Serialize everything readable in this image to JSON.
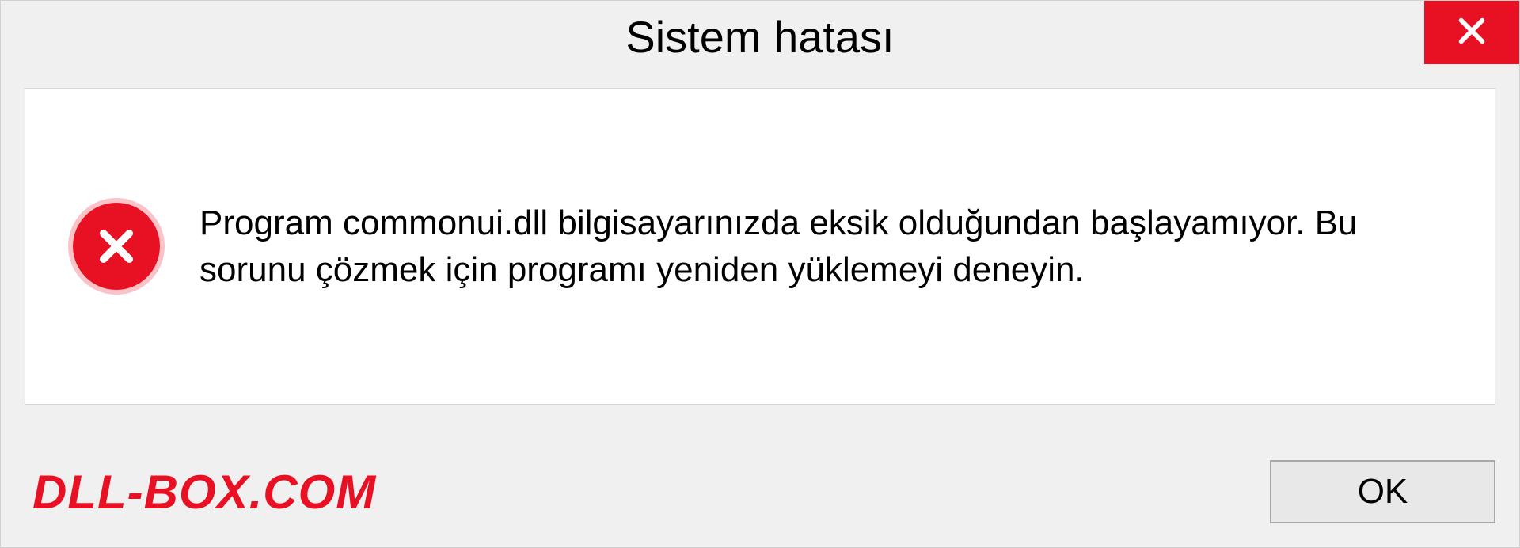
{
  "title": "Sistem hatası",
  "message": "Program commonui.dll bilgisayarınızda eksik olduğundan başlayamıyor. Bu sorunu çözmek için programı yeniden yüklemeyi deneyin.",
  "watermark": "DLL-BOX.COM",
  "buttons": {
    "ok": "OK"
  },
  "colors": {
    "error": "#e81123",
    "background": "#f0f0f0",
    "panel": "#ffffff"
  }
}
